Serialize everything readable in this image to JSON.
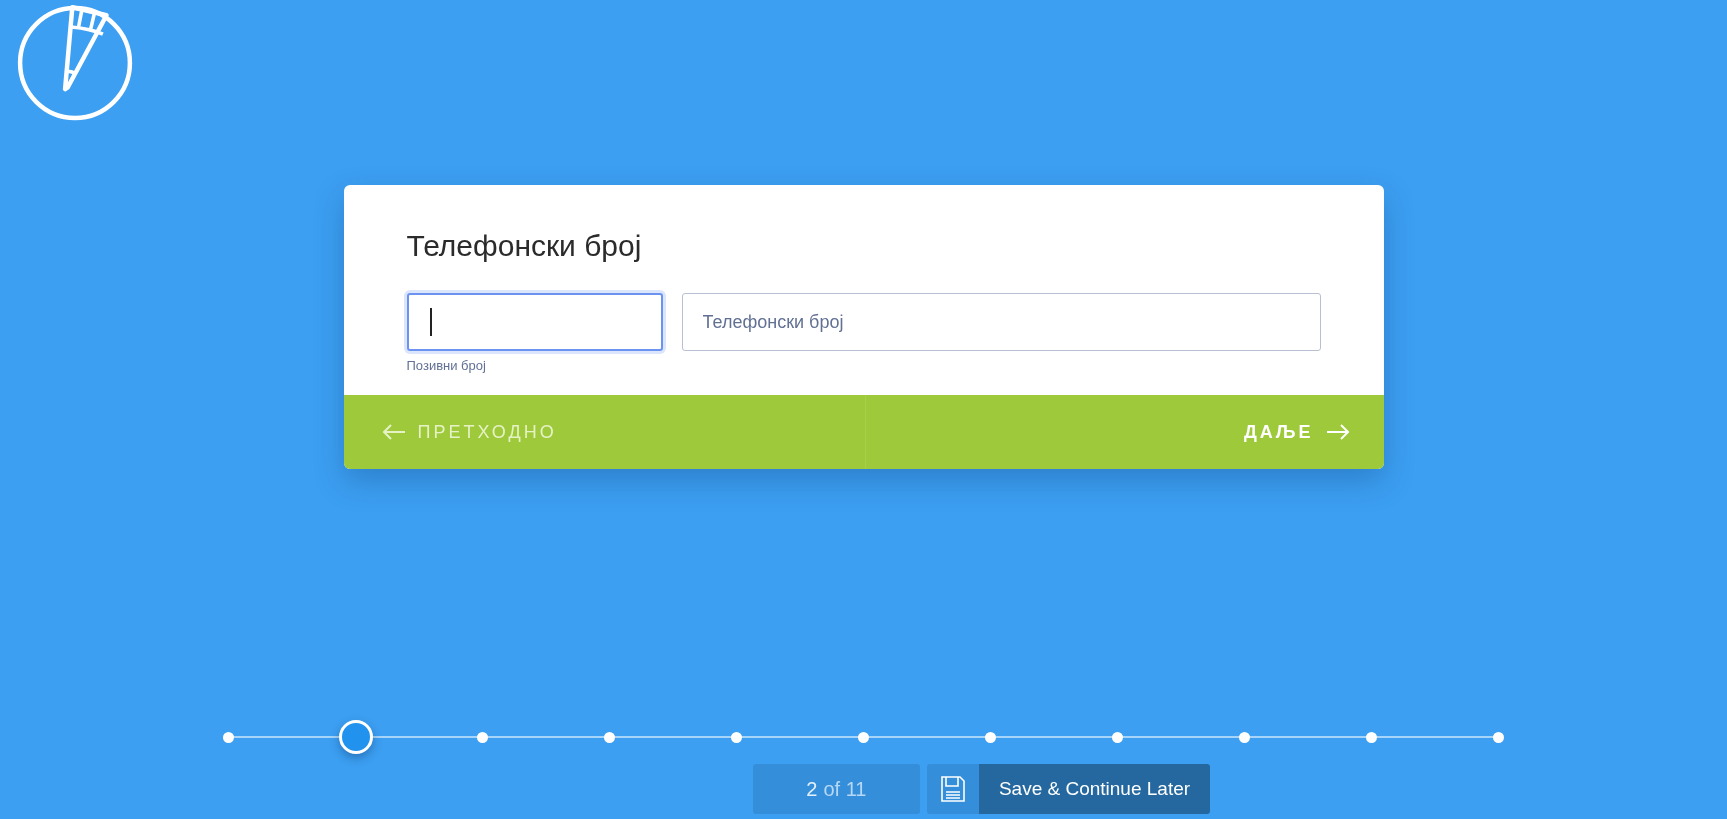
{
  "form": {
    "title": "Телефонски број",
    "fields": [
      {
        "kind": "code",
        "hint": "Позивни број",
        "focused": true
      },
      {
        "kind": "number",
        "placeholder": "Телефонски број",
        "focused": false
      }
    ],
    "prev_button": "ПРЕТХОДНО",
    "next_button": "ДАЉЕ"
  },
  "steps": [
    {
      "selected": false
    },
    {
      "selected": true
    },
    {
      "selected": false
    },
    {
      "selected": false
    },
    {
      "selected": false
    },
    {
      "selected": false
    },
    {
      "selected": false
    },
    {
      "selected": false
    },
    {
      "selected": false
    },
    {
      "selected": false
    },
    {
      "selected": false
    }
  ],
  "counter": {
    "current": "2",
    "rest": "of 11"
  },
  "save_button": "Save & Continue Later"
}
